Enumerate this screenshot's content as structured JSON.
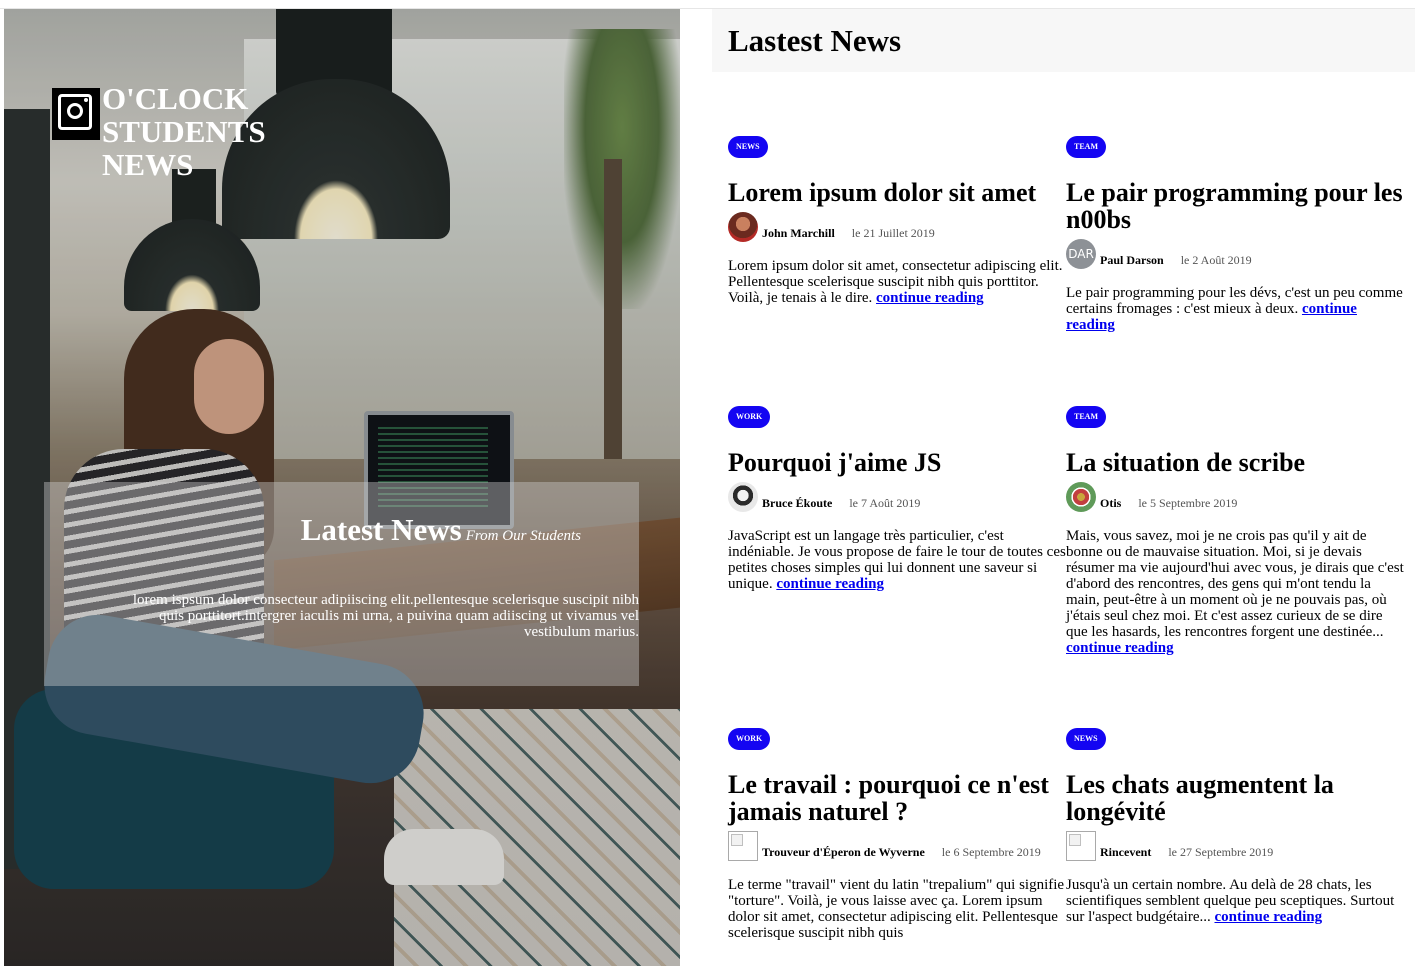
{
  "brand": {
    "name": "O'CLOCK STUDENTS NEWS",
    "logo_icon": "camera-logo-icon"
  },
  "hero": {
    "title": "Latest News",
    "subtitle": "From Our Students",
    "text": "lorem ispsum dolor consecteur adipiiscing elit.pellentesque scelerisque suscipit nibh quis porttitort.intergrer iaculis mi urna, a puivina quam adiiscing ut vivamus vel vestibulum marius."
  },
  "main": {
    "heading": "Lastest News"
  },
  "colors": {
    "tag": "#1405f2",
    "link": "#0000ee",
    "header_bg": "#f7f7f7"
  },
  "articles": [
    {
      "tag": "NEWS",
      "title": "Lorem ipsum dolor sit amet",
      "author": "John Marchill",
      "date": "le 21 Juillet 2019",
      "excerpt": "Lorem ipsum dolor sit amet, consectetur adipiscing elit. Pellentesque scelerisque suscipit nibh quis porttitor. Voilà, je tenais à le dire.",
      "link": "continue reading"
    },
    {
      "tag": "TEAM",
      "title": "Le pair programming pour les n00bs",
      "author": "Paul Darson",
      "avatar_text": "DAR",
      "date": "le 2 Août 2019",
      "excerpt": "Le pair programming pour les dévs, c'est un peu comme certains fromages : c'est mieux à deux.",
      "link": "continue reading"
    },
    {
      "tag": "WORK",
      "title": "Pourquoi j'aime JS",
      "author": "Bruce Ékoute",
      "date": "le 7 Août 2019",
      "excerpt": "JavaScript est un langage très particulier, c'est indéniable. Je vous propose de faire le tour de toutes ces petites choses simples qui lui donnent une saveur si unique.",
      "link": "continue reading"
    },
    {
      "tag": "TEAM",
      "title": "La situation de scribe",
      "author": "Otis",
      "date": "le 5 Septembre 2019",
      "excerpt": "Mais, vous savez, moi je ne crois pas qu'il y ait de bonne ou de mauvaise situation. Moi, si je devais résumer ma vie aujourd'hui avec vous, je dirais que c'est d'abord des rencontres, des gens qui m'ont tendu la main, peut-être à un moment où je ne pouvais pas, où j'étais seul chez moi. Et c'est assez curieux de se dire que les hasards, les rencontres forgent une destinée...",
      "link": "continue reading"
    },
    {
      "tag": "WORK",
      "title": "Le travail : pourquoi ce n'est jamais naturel ?",
      "author": "Trouveur d'Éperon de Wyverne",
      "date": "le 6 Septembre 2019",
      "excerpt": "Le terme \"travail\" vient du latin \"trepalium\" qui signifie \"torture\". Voilà, je vous laisse avec ça. Lorem ipsum dolor sit amet, consectetur adipiscing elit. Pellentesque scelerisque suscipit nibh quis",
      "link": ""
    },
    {
      "tag": "NEWS",
      "title": "Les chats augmentent la longévité",
      "author": "Rincevent",
      "date": "le 27 Septembre 2019",
      "excerpt": "Jusqu'à un certain nombre. Au delà de 28 chats, les scientifiques semblent quelque peu sceptiques. Surtout sur l'aspect budgétaire...",
      "link": "continue reading"
    }
  ]
}
